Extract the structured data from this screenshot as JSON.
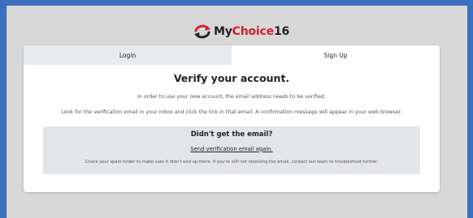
{
  "logo": {
    "brand_my": "My",
    "brand_choice": "Choice",
    "brand_num": "16",
    "icon": "mychoice-arrows-logo-icon",
    "colors": {
      "red": "#d4202a",
      "dark": "#222222"
    }
  },
  "tabs": [
    {
      "label": "Login",
      "active": false
    },
    {
      "label": "Sign Up",
      "active": true
    }
  ],
  "verify": {
    "title": "Verify your account.",
    "intro": "In order to use your new account, the email address needs to be verified.",
    "instructions": "Look for the verification email in your inbox and click the link in that email. A confirmation message will appear in your web browser."
  },
  "notice": {
    "title": "Didn't get the email?",
    "resend_link": "Send verification email again.",
    "help_text": "Check your spam folder to make sure it didn't end up there. If you're still not receiving the email, contact our team to troubleshoot further."
  },
  "colors": {
    "page_border": "#3d6fc1",
    "background": "#d8d8d8",
    "card": "#ffffff",
    "inactive_tab": "#e7eaee",
    "notice_box": "#e3e5e8"
  }
}
